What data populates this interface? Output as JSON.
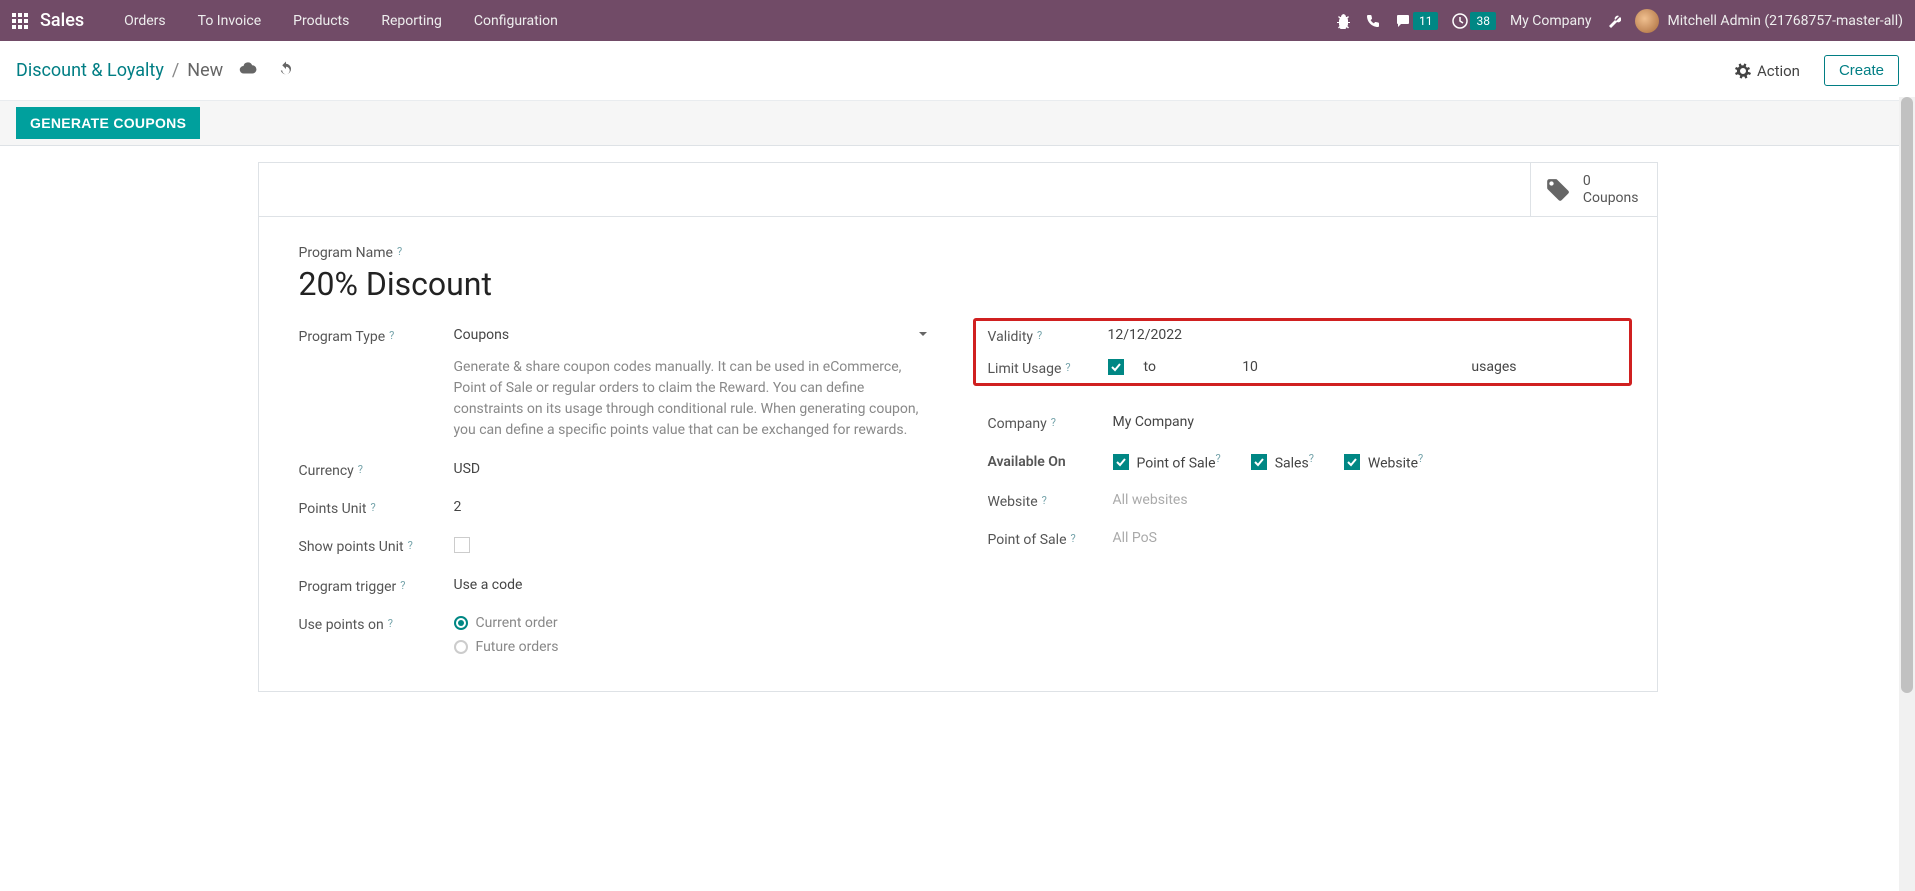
{
  "navbar": {
    "brand": "Sales",
    "menu": [
      "Orders",
      "To Invoice",
      "Products",
      "Reporting",
      "Configuration"
    ],
    "messages_count": "11",
    "activities_count": "38",
    "company": "My Company",
    "user": "Mitchell Admin (21768757-master-all)"
  },
  "breadcrumb": {
    "parent": "Discount & Loyalty",
    "current": "New",
    "action": "Action",
    "create": "Create"
  },
  "statusbar": {
    "generate": "GENERATE COUPONS"
  },
  "stat": {
    "count": "0",
    "label": "Coupons"
  },
  "form": {
    "program_name_label": "Program Name",
    "program_name": "20% Discount",
    "program_type_label": "Program Type",
    "program_type": "Coupons",
    "program_type_help": "Generate & share coupon codes manually. It can be used in eCommerce, Point of Sale or regular orders to claim the Reward. You can define constraints on its usage through conditional rule. When generating coupon, you can define a specific points value that can be exchanged for rewards.",
    "currency_label": "Currency",
    "currency": "USD",
    "points_unit_label": "Points Unit",
    "points_unit": "2",
    "show_points_label": "Show points Unit",
    "trigger_label": "Program trigger",
    "trigger": "Use a code",
    "use_points_label": "Use points on",
    "use_points_opt1": "Current order",
    "use_points_opt2": "Future orders",
    "validity_label": "Validity",
    "validity": "12/12/2022",
    "limit_usage_label": "Limit Usage",
    "limit_to": "to",
    "limit_value": "10",
    "limit_unit": "usages",
    "company_label": "Company",
    "company_value": "My Company",
    "available_label": "Available On",
    "available_pos": "Point of Sale",
    "available_sales": "Sales",
    "available_website": "Website",
    "website_label": "Website",
    "website_placeholder": "All websites",
    "pos_label": "Point of Sale",
    "pos_placeholder": "All PoS"
  }
}
